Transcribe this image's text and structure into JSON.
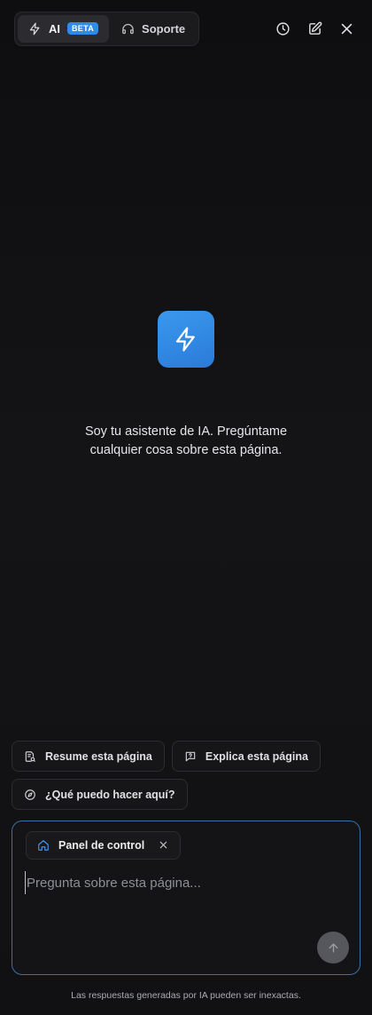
{
  "header": {
    "tabs": [
      {
        "label": "AI",
        "badge": "BETA",
        "icon": "lightning-icon",
        "active": true
      },
      {
        "label": "Soporte",
        "icon": "headphones-icon",
        "active": false
      }
    ],
    "actions": [
      "history-icon",
      "edit-icon",
      "close-icon"
    ]
  },
  "hero": {
    "icon": "lightning-icon",
    "text": "Soy tu asistente de IA. Pregúntame cualquier cosa sobre esta página."
  },
  "suggestions": [
    {
      "label": "Resume esta página",
      "icon": "document-search-icon"
    },
    {
      "label": "Explica esta página",
      "icon": "question-bubble-icon"
    },
    {
      "label": "¿Qué puedo hacer aquí?",
      "icon": "compass-icon"
    }
  ],
  "composer": {
    "context_label": "Panel de control",
    "context_icon": "home-icon",
    "placeholder": "Pregunta sobre esta página...",
    "value": ""
  },
  "disclaimer": "Las respuestas generadas por IA pueden ser inexactas.",
  "colors": {
    "accent": "#2f8be6",
    "background": "#0f0f11",
    "composer_border": "#3c6fa8"
  }
}
